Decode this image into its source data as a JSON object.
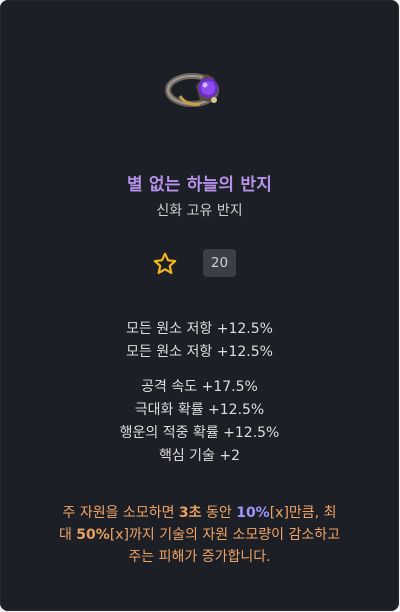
{
  "item": {
    "name": "별 없는 하늘의 반지",
    "type": "신화 고유 반지",
    "level": "20",
    "image_icon": "ring-icon"
  },
  "favorite_icon": "star-outline-icon",
  "stats": {
    "implicit": [
      "모든 원소 저항 +12.5%",
      "모든 원소 저항 +12.5%"
    ],
    "affixes": [
      "공격 속도 +17.5%",
      "극대화 확률 +12.5%",
      "행운의 적중 확률 +12.5%",
      "핵심 기술 +2"
    ]
  },
  "description": {
    "l1_a": "주 자원을 소모하면 ",
    "l1_b": "3초",
    "l1_c": " 동안 ",
    "l1_d": "10%",
    "l1_e": "[x]만큼, 최",
    "l2_a": "대 ",
    "l2_b": "50%",
    "l2_c": "[x]까지 기술의 자원 소모량이 감소하고",
    "l3": "주는 피해가 증가합니다."
  },
  "colors": {
    "name": "#b591e8",
    "description": "#f0a366",
    "highlight": "#9f97ff",
    "star": "#f2b51c"
  }
}
